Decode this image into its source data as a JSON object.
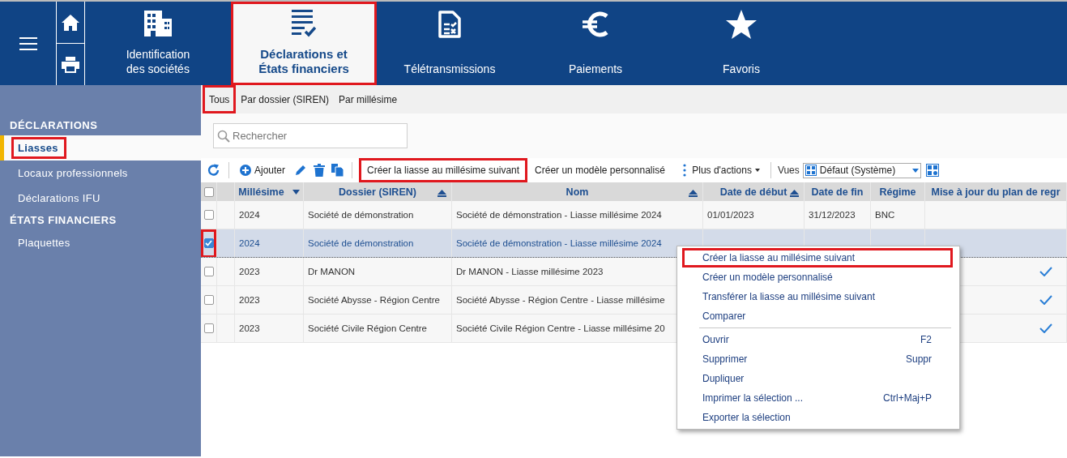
{
  "header": {
    "side_buttons": [
      {
        "kind": "home"
      },
      {
        "kind": "print"
      }
    ],
    "nav": [
      {
        "label": "Identification\ndes sociétés",
        "kind": "building",
        "selected": false,
        "highlighted": false
      },
      {
        "label": "Déclarations et\nÉtats financiers",
        "kind": "list-check",
        "selected": true,
        "highlighted": true
      },
      {
        "label": "Télétransmissions",
        "kind": "document",
        "selected": false,
        "highlighted": false
      },
      {
        "label": "Paiements",
        "kind": "euro",
        "selected": false,
        "highlighted": false
      },
      {
        "label": "Favoris",
        "kind": "star",
        "selected": false,
        "highlighted": false
      }
    ]
  },
  "sidebar": {
    "sections": [
      {
        "title": "DÉCLARATIONS",
        "items": [
          {
            "label": "Liasses",
            "selected": true,
            "highlighted": true
          },
          {
            "label": "Locaux professionnels",
            "selected": false,
            "highlighted": false
          },
          {
            "label": "Déclarations IFU",
            "selected": false,
            "highlighted": false
          }
        ]
      },
      {
        "title": "ÉTATS FINANCIERS",
        "items": [
          {
            "label": "Plaquettes",
            "selected": false,
            "highlighted": false
          }
        ]
      }
    ]
  },
  "tabs": [
    {
      "label": "Tous",
      "selected": true,
      "highlighted": true
    },
    {
      "label": "Par dossier (SIREN)",
      "selected": false,
      "highlighted": false
    },
    {
      "label": "Par millésime",
      "selected": false,
      "highlighted": false
    }
  ],
  "search": {
    "placeholder": "Rechercher"
  },
  "toolbar": {
    "add_label": "Ajouter",
    "actions": [
      {
        "label": "Créer la liasse au millésime suivant",
        "highlighted": true
      },
      {
        "label": "Créer un modèle personnalisé",
        "highlighted": false
      }
    ],
    "more_label": "Plus d'actions",
    "views_label": "Vues",
    "view_value": "Défaut (Système)"
  },
  "table": {
    "header_checked": false,
    "columns": [
      {
        "label": "Millésime",
        "sort_descending": true,
        "sort_ascending": false
      },
      {
        "label": "Dossier (SIREN)",
        "sort_descending": false,
        "sort_ascending": true
      },
      {
        "label": "Nom",
        "sort_descending": false,
        "sort_ascending": true
      },
      {
        "label": "Date de début",
        "sort_descending": false,
        "sort_ascending": true
      },
      {
        "label": "Date de fin",
        "sort_descending": false,
        "sort_ascending": false
      },
      {
        "label": "Régime",
        "sort_descending": false,
        "sort_ascending": false
      },
      {
        "label": "Mise à jour du plan de regr",
        "sort_descending": false,
        "sort_ascending": false
      }
    ],
    "rows": [
      {
        "selected": false,
        "checked": false,
        "highlighted": false,
        "cells": [
          "2024",
          "Société de démonstration",
          "Société de démonstration - Liasse millésime 2024",
          "01/01/2023",
          "31/12/2023",
          "BNC"
        ],
        "updated": false
      },
      {
        "selected": true,
        "checked": true,
        "highlighted": true,
        "cells": [
          "2024",
          "Société de démonstration",
          "Société de démonstration - Liasse millésime 2024"
        ],
        "updated": false
      },
      {
        "selected": false,
        "checked": false,
        "highlighted": false,
        "cells": [
          "2023",
          "Dr MANON",
          "Dr MANON - Liasse millésime 2023"
        ],
        "updated": true
      },
      {
        "selected": false,
        "checked": false,
        "highlighted": false,
        "cells": [
          "2023",
          "Société Abysse - Région Centre",
          "Société Abysse - Région Centre - Liasse millésime"
        ],
        "updated": true
      },
      {
        "selected": false,
        "checked": false,
        "highlighted": false,
        "cells": [
          "2023",
          "Société Civile Région Centre",
          "Société Civile Région Centre - Liasse millésime 20"
        ],
        "updated": true
      }
    ]
  },
  "context_menu": {
    "groups": [
      {
        "items": [
          {
            "label": "Créer la liasse au millésime suivant",
            "highlighted": true
          },
          {
            "label": "Créer un modèle personnalisé",
            "highlighted": false
          },
          {
            "label": "Transférer la liasse au millésime suivant",
            "highlighted": false
          },
          {
            "label": "Comparer",
            "highlighted": false
          }
        ]
      },
      {
        "items": [
          {
            "label": "Ouvrir",
            "shortcut": "F2",
            "highlighted": false
          },
          {
            "label": "Supprimer",
            "shortcut": "Suppr",
            "highlighted": false
          },
          {
            "label": "Dupliquer",
            "highlighted": false
          },
          {
            "label": "Imprimer la sélection ...",
            "shortcut": "Ctrl+Maj+P",
            "highlighted": false
          },
          {
            "label": "Exporter la sélection",
            "highlighted": false
          }
        ]
      }
    ]
  }
}
